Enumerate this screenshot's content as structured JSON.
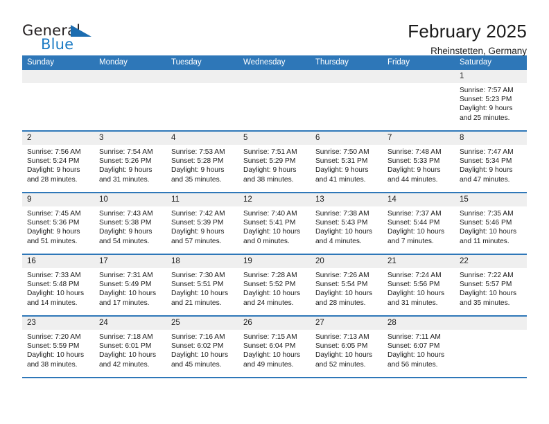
{
  "logo": {
    "word_top": "General",
    "word_bottom": "Blue",
    "triangle_color": "#1b6cb0",
    "blue_text_color": "#1b7bc4"
  },
  "header": {
    "title": "February 2025",
    "subtitle": "Rheinstetten, Germany"
  },
  "theme": {
    "header_bar": "#2e77b8",
    "daynum_band": "#efefef",
    "row_rule": "#2e77b8"
  },
  "weekdays": [
    "Sunday",
    "Monday",
    "Tuesday",
    "Wednesday",
    "Thursday",
    "Friday",
    "Saturday"
  ],
  "weeks": [
    [
      {
        "day": "",
        "lines": []
      },
      {
        "day": "",
        "lines": []
      },
      {
        "day": "",
        "lines": []
      },
      {
        "day": "",
        "lines": []
      },
      {
        "day": "",
        "lines": []
      },
      {
        "day": "",
        "lines": []
      },
      {
        "day": "1",
        "lines": [
          "Sunrise: 7:57 AM",
          "Sunset: 5:23 PM",
          "Daylight: 9 hours",
          "and 25 minutes."
        ]
      }
    ],
    [
      {
        "day": "2",
        "lines": [
          "Sunrise: 7:56 AM",
          "Sunset: 5:24 PM",
          "Daylight: 9 hours",
          "and 28 minutes."
        ]
      },
      {
        "day": "3",
        "lines": [
          "Sunrise: 7:54 AM",
          "Sunset: 5:26 PM",
          "Daylight: 9 hours",
          "and 31 minutes."
        ]
      },
      {
        "day": "4",
        "lines": [
          "Sunrise: 7:53 AM",
          "Sunset: 5:28 PM",
          "Daylight: 9 hours",
          "and 35 minutes."
        ]
      },
      {
        "day": "5",
        "lines": [
          "Sunrise: 7:51 AM",
          "Sunset: 5:29 PM",
          "Daylight: 9 hours",
          "and 38 minutes."
        ]
      },
      {
        "day": "6",
        "lines": [
          "Sunrise: 7:50 AM",
          "Sunset: 5:31 PM",
          "Daylight: 9 hours",
          "and 41 minutes."
        ]
      },
      {
        "day": "7",
        "lines": [
          "Sunrise: 7:48 AM",
          "Sunset: 5:33 PM",
          "Daylight: 9 hours",
          "and 44 minutes."
        ]
      },
      {
        "day": "8",
        "lines": [
          "Sunrise: 7:47 AM",
          "Sunset: 5:34 PM",
          "Daylight: 9 hours",
          "and 47 minutes."
        ]
      }
    ],
    [
      {
        "day": "9",
        "lines": [
          "Sunrise: 7:45 AM",
          "Sunset: 5:36 PM",
          "Daylight: 9 hours",
          "and 51 minutes."
        ]
      },
      {
        "day": "10",
        "lines": [
          "Sunrise: 7:43 AM",
          "Sunset: 5:38 PM",
          "Daylight: 9 hours",
          "and 54 minutes."
        ]
      },
      {
        "day": "11",
        "lines": [
          "Sunrise: 7:42 AM",
          "Sunset: 5:39 PM",
          "Daylight: 9 hours",
          "and 57 minutes."
        ]
      },
      {
        "day": "12",
        "lines": [
          "Sunrise: 7:40 AM",
          "Sunset: 5:41 PM",
          "Daylight: 10 hours",
          "and 0 minutes."
        ]
      },
      {
        "day": "13",
        "lines": [
          "Sunrise: 7:38 AM",
          "Sunset: 5:43 PM",
          "Daylight: 10 hours",
          "and 4 minutes."
        ]
      },
      {
        "day": "14",
        "lines": [
          "Sunrise: 7:37 AM",
          "Sunset: 5:44 PM",
          "Daylight: 10 hours",
          "and 7 minutes."
        ]
      },
      {
        "day": "15",
        "lines": [
          "Sunrise: 7:35 AM",
          "Sunset: 5:46 PM",
          "Daylight: 10 hours",
          "and 11 minutes."
        ]
      }
    ],
    [
      {
        "day": "16",
        "lines": [
          "Sunrise: 7:33 AM",
          "Sunset: 5:48 PM",
          "Daylight: 10 hours",
          "and 14 minutes."
        ]
      },
      {
        "day": "17",
        "lines": [
          "Sunrise: 7:31 AM",
          "Sunset: 5:49 PM",
          "Daylight: 10 hours",
          "and 17 minutes."
        ]
      },
      {
        "day": "18",
        "lines": [
          "Sunrise: 7:30 AM",
          "Sunset: 5:51 PM",
          "Daylight: 10 hours",
          "and 21 minutes."
        ]
      },
      {
        "day": "19",
        "lines": [
          "Sunrise: 7:28 AM",
          "Sunset: 5:52 PM",
          "Daylight: 10 hours",
          "and 24 minutes."
        ]
      },
      {
        "day": "20",
        "lines": [
          "Sunrise: 7:26 AM",
          "Sunset: 5:54 PM",
          "Daylight: 10 hours",
          "and 28 minutes."
        ]
      },
      {
        "day": "21",
        "lines": [
          "Sunrise: 7:24 AM",
          "Sunset: 5:56 PM",
          "Daylight: 10 hours",
          "and 31 minutes."
        ]
      },
      {
        "day": "22",
        "lines": [
          "Sunrise: 7:22 AM",
          "Sunset: 5:57 PM",
          "Daylight: 10 hours",
          "and 35 minutes."
        ]
      }
    ],
    [
      {
        "day": "23",
        "lines": [
          "Sunrise: 7:20 AM",
          "Sunset: 5:59 PM",
          "Daylight: 10 hours",
          "and 38 minutes."
        ]
      },
      {
        "day": "24",
        "lines": [
          "Sunrise: 7:18 AM",
          "Sunset: 6:01 PM",
          "Daylight: 10 hours",
          "and 42 minutes."
        ]
      },
      {
        "day": "25",
        "lines": [
          "Sunrise: 7:16 AM",
          "Sunset: 6:02 PM",
          "Daylight: 10 hours",
          "and 45 minutes."
        ]
      },
      {
        "day": "26",
        "lines": [
          "Sunrise: 7:15 AM",
          "Sunset: 6:04 PM",
          "Daylight: 10 hours",
          "and 49 minutes."
        ]
      },
      {
        "day": "27",
        "lines": [
          "Sunrise: 7:13 AM",
          "Sunset: 6:05 PM",
          "Daylight: 10 hours",
          "and 52 minutes."
        ]
      },
      {
        "day": "28",
        "lines": [
          "Sunrise: 7:11 AM",
          "Sunset: 6:07 PM",
          "Daylight: 10 hours",
          "and 56 minutes."
        ]
      },
      {
        "day": "",
        "lines": []
      }
    ]
  ]
}
